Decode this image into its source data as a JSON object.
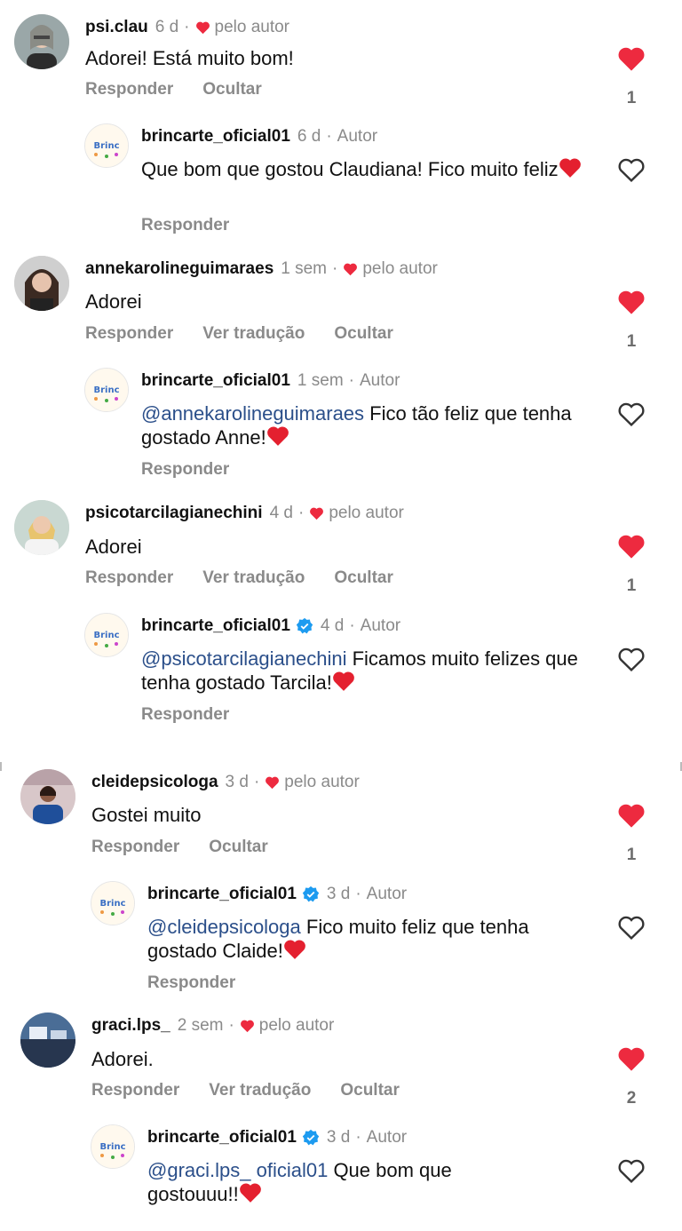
{
  "colors": {
    "like_red": "#ed2a3f",
    "verified_blue": "#1d9bf0",
    "muted": "#8a8a8a",
    "mention": "#2b4f8a"
  },
  "labels": {
    "reply": "Responder",
    "hide": "Ocultar",
    "translate": "Ver tradução",
    "liked_by_author": "pelo autor",
    "author": "Autor",
    "dot": "·"
  },
  "threads": [
    {
      "comment": {
        "username": "psi.clau",
        "time": "6 d",
        "text": "Adorei! Está muito bom!",
        "likes": "1",
        "translate": false,
        "avatar_icon": "user-photo-avatar"
      },
      "reply": {
        "username": "brincarte_oficial01",
        "time": "6 d",
        "verified": false,
        "mention": "",
        "text": "Que bom que gostou Claudiana! Fico muito feliz",
        "emoji": "red-heart-emoji",
        "avatar_icon": "brincarte-logo-avatar"
      }
    },
    {
      "comment": {
        "username": "annekarolineguimaraes",
        "time": "1 sem",
        "text": "Adorei",
        "likes": "1",
        "translate": true,
        "avatar_icon": "user-photo-avatar"
      },
      "reply": {
        "username": "brincarte_oficial01",
        "time": "1 sem",
        "verified": false,
        "mention": "@annekarolineguimaraes",
        "text": " Fico tão feliz que tenha gostado Anne!",
        "emoji": "red-heart-emoji",
        "avatar_icon": "brincarte-logo-avatar"
      }
    },
    {
      "comment": {
        "username": "psicotarcilagianechini",
        "time": "4 d",
        "text": "Adorei",
        "likes": "1",
        "translate": true,
        "avatar_icon": "user-photo-avatar"
      },
      "reply": {
        "username": "brincarte_oficial01",
        "time": "4 d",
        "verified": true,
        "mention": "@psicotarcilagianechini",
        "text": " Ficamos muito felizes que tenha gostado Tarcila!",
        "emoji": "red-heart-emoji",
        "avatar_icon": "brincarte-logo-avatar"
      }
    },
    {
      "comment": {
        "username": "cleidepsicologa",
        "time": "3 d",
        "text": "Gostei muito",
        "likes": "1",
        "translate": false,
        "avatar_icon": "user-photo-avatar"
      },
      "reply": {
        "username": "brincarte_oficial01",
        "time": "3 d",
        "verified": true,
        "mention": "@cleidepsicologa",
        "text": " Fico muito feliz que tenha gostado Claide!",
        "emoji": "red-heart-emoji",
        "avatar_icon": "brincarte-logo-avatar"
      }
    },
    {
      "comment": {
        "username": "graci.lps_",
        "time": "2 sem",
        "text": "Adorei.",
        "likes": "2",
        "translate": true,
        "avatar_icon": "user-photo-avatar"
      },
      "reply": {
        "username": "brincarte_oficial01",
        "time": "3 d",
        "verified": true,
        "mention": "@graci.lps_ oficial01",
        "text": " Que bom que gostouuu!!",
        "emoji": "red-heart-emoji",
        "avatar_icon": "brincarte-logo-avatar"
      }
    }
  ]
}
